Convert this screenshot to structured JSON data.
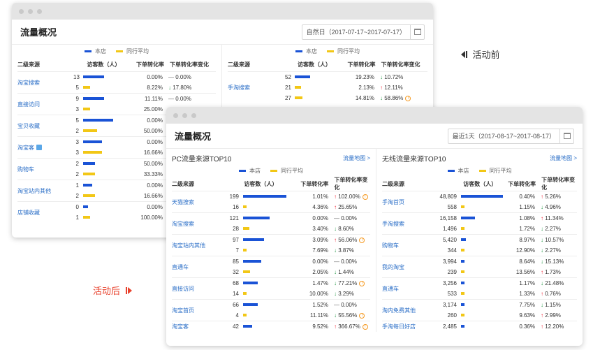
{
  "colors": {
    "store": "#1a53d6",
    "peer": "#f2c716",
    "link": "#2a6ec7",
    "up": "#e23",
    "down": "#2a9a4b"
  },
  "notes": {
    "before": "活动前",
    "after": "活动后"
  },
  "before": {
    "title": "流量概况",
    "date": "自然日（2017-07-17~2017-07-17）",
    "panels": [
      {
        "legend_store": "本店",
        "legend_peer": "同行平均",
        "headers": [
          "二级来源",
          "访客数（人）",
          "下单转化率",
          "下单转化率变化"
        ],
        "max": 9,
        "groups": [
          {
            "name": "淘宝搜索",
            "rows": [
              {
                "n": "13",
                "v": 9,
                "r": "0.00%",
                "c": "0.00%",
                "d": "flat"
              },
              {
                "n": "5",
                "v": 3,
                "r": "8.22%",
                "c": "17.80%",
                "d": "down"
              }
            ]
          },
          {
            "name": "直接访问",
            "rows": [
              {
                "n": "9",
                "v": 9,
                "r": "11.11%",
                "c": "0.00%",
                "d": "flat"
              },
              {
                "n": "3",
                "v": 3,
                "r": "25.00%",
                "c": "",
                "d": ""
              }
            ]
          },
          {
            "name": "宝贝收藏",
            "rows": [
              {
                "n": "5",
                "v": 13,
                "r": "0.00%",
                "c": "",
                "d": ""
              },
              {
                "n": "2",
                "v": 6,
                "r": "50.00%",
                "c": "",
                "d": ""
              }
            ]
          },
          {
            "name": "淘宝客",
            "tag": true,
            "rows": [
              {
                "n": "3",
                "v": 8,
                "r": "0.00%",
                "c": "",
                "d": ""
              },
              {
                "n": "3",
                "v": 8,
                "r": "16.66%",
                "c": "",
                "d": ""
              }
            ]
          },
          {
            "name": "购物车",
            "rows": [
              {
                "n": "2",
                "v": 5,
                "r": "50.00%",
                "c": "",
                "d": ""
              },
              {
                "n": "2",
                "v": 5,
                "r": "33.33%",
                "c": "",
                "d": ""
              }
            ]
          },
          {
            "name": "淘宝站内其他",
            "rows": [
              {
                "n": "1",
                "v": 4,
                "r": "0.00%",
                "c": "",
                "d": ""
              },
              {
                "n": "2",
                "v": 5,
                "r": "16.66%",
                "c": "",
                "d": ""
              }
            ]
          },
          {
            "name": "店铺收藏",
            "rows": [
              {
                "n": "0",
                "v": 2,
                "r": "0.00%",
                "c": "",
                "d": ""
              },
              {
                "n": "1",
                "v": 3,
                "r": "100.00%",
                "c": "",
                "d": ""
              }
            ]
          }
        ]
      },
      {
        "legend_store": "本店",
        "legend_peer": "同行平均",
        "headers": [
          "二级来源",
          "访客数（人）",
          "下单转化率",
          "下单转化率变化"
        ],
        "max": 52,
        "groups": [
          {
            "name": "手淘搜索",
            "rows": [
              {
                "n": "52",
                "v": 52,
                "r": "19.23%",
                "c": "10.72%",
                "d": "down"
              },
              {
                "n": "21",
                "v": 21,
                "r": "2.13%",
                "c": "12.11%",
                "d": "up"
              },
              {
                "n": "27",
                "v": 27,
                "r": "14.81%",
                "c": "58.86%",
                "d": "down",
                "info": true
              }
            ]
          }
        ]
      }
    ]
  },
  "after": {
    "title": "流量概况",
    "date": "最近1天（2017-08-17~2017-08-17）",
    "panels": [
      {
        "title": "PC流量来源TOP10",
        "link": "流量地图 >",
        "legend_store": "本店",
        "legend_peer": "同行平均",
        "headers": [
          "二级来源",
          "访客数（人）",
          "下单转化率",
          "下单转化率变化"
        ],
        "max": 199,
        "groups": [
          {
            "name": "天猫搜索",
            "rows": [
              {
                "n": "199",
                "v": 199,
                "r": "1.01%",
                "c": "102.00%",
                "d": "up",
                "info": true
              },
              {
                "n": "16",
                "v": 16,
                "r": "4.36%",
                "c": "25.65%",
                "d": "up"
              }
            ]
          },
          {
            "name": "淘宝搜索",
            "rows": [
              {
                "n": "121",
                "v": 121,
                "r": "0.00%",
                "c": "0.00%",
                "d": "flat"
              },
              {
                "n": "28",
                "v": 28,
                "r": "3.40%",
                "c": "8.60%",
                "d": "down"
              }
            ]
          },
          {
            "name": "淘宝站内其他",
            "rows": [
              {
                "n": "97",
                "v": 97,
                "r": "3.09%",
                "c": "56.06%",
                "d": "up",
                "info": true
              },
              {
                "n": "7",
                "v": 7,
                "r": "7.69%",
                "c": "3.87%",
                "d": "down"
              }
            ]
          },
          {
            "name": "直通车",
            "rows": [
              {
                "n": "85",
                "v": 85,
                "r": "0.00%",
                "c": "0.00%",
                "d": "flat"
              },
              {
                "n": "32",
                "v": 32,
                "r": "2.05%",
                "c": "1.44%",
                "d": "down"
              }
            ]
          },
          {
            "name": "直接访问",
            "rows": [
              {
                "n": "68",
                "v": 68,
                "r": "1.47%",
                "c": "77.21%",
                "d": "down",
                "info": true
              },
              {
                "n": "14",
                "v": 14,
                "r": "10.00%",
                "c": "3.29%",
                "d": "down"
              }
            ]
          },
          {
            "name": "淘宝首页",
            "rows": [
              {
                "n": "66",
                "v": 66,
                "r": "1.52%",
                "c": "0.00%",
                "d": "flat"
              },
              {
                "n": "4",
                "v": 4,
                "r": "11.11%",
                "c": "55.56%",
                "d": "down",
                "info": true
              }
            ]
          },
          {
            "name": "淘宝客",
            "rows": [
              {
                "n": "42",
                "v": 42,
                "r": "9.52%",
                "c": "366.67%",
                "d": "up",
                "info": true
              }
            ]
          }
        ]
      },
      {
        "title": "无线流量来源TOP10",
        "link": "流量地图 >",
        "legend_store": "本店",
        "legend_peer": "同行平均",
        "headers": [
          "二级来源",
          "访客数（人）",
          "下单转化率",
          "下单转化率变化"
        ],
        "max": 48809,
        "groups": [
          {
            "name": "手淘首页",
            "rows": [
              {
                "n": "48,809",
                "v": 48809,
                "r": "0.40%",
                "c": "5.26%",
                "d": "up"
              },
              {
                "n": "558",
                "v": 558,
                "r": "1.15%",
                "c": "4.96%",
                "d": "down"
              }
            ]
          },
          {
            "name": "手淘搜索",
            "rows": [
              {
                "n": "16,158",
                "v": 16158,
                "r": "1.08%",
                "c": "11.34%",
                "d": "up"
              },
              {
                "n": "1,496",
                "v": 1496,
                "r": "1.72%",
                "c": "2.27%",
                "d": "down"
              }
            ]
          },
          {
            "name": "购物车",
            "rows": [
              {
                "n": "5,420",
                "v": 5420,
                "r": "8.97%",
                "c": "10.57%",
                "d": "down"
              },
              {
                "n": "344",
                "v": 344,
                "r": "12.90%",
                "c": "2.27%",
                "d": "down"
              }
            ]
          },
          {
            "name": "我的淘宝",
            "rows": [
              {
                "n": "3,994",
                "v": 3994,
                "r": "8.64%",
                "c": "15.13%",
                "d": "down"
              },
              {
                "n": "239",
                "v": 239,
                "r": "13.56%",
                "c": "1.73%",
                "d": "up"
              }
            ]
          },
          {
            "name": "直通车",
            "rows": [
              {
                "n": "3,256",
                "v": 3256,
                "r": "1.17%",
                "c": "21.48%",
                "d": "down"
              },
              {
                "n": "533",
                "v": 533,
                "r": "1.33%",
                "c": "0.76%",
                "d": "up"
              }
            ]
          },
          {
            "name": "淘内免费其他",
            "rows": [
              {
                "n": "3,174",
                "v": 3174,
                "r": "7.75%",
                "c": "1.15%",
                "d": "down"
              },
              {
                "n": "260",
                "v": 260,
                "r": "9.63%",
                "c": "2.99%",
                "d": "up"
              }
            ]
          },
          {
            "name": "手淘每日好店",
            "rows": [
              {
                "n": "2,485",
                "v": 2485,
                "r": "0.36%",
                "c": "12.20%",
                "d": "up"
              }
            ]
          }
        ]
      }
    ]
  }
}
